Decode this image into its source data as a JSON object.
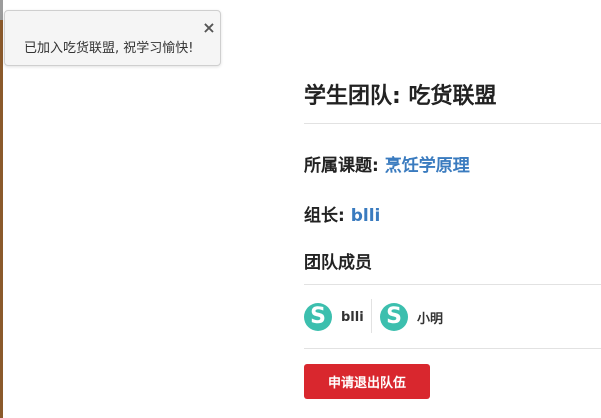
{
  "toast": {
    "message": "已加入吃货联盟, 祝学习愉快!",
    "close_icon": "close-icon",
    "close_glyph": "×"
  },
  "page": {
    "title": "学生团队: 吃货联盟"
  },
  "course": {
    "label": "所属课题: ",
    "value": "烹饪学原理"
  },
  "leader": {
    "label": "组长: ",
    "value": "blli"
  },
  "members_section": {
    "title": "团队成员",
    "members": [
      {
        "avatar_letter": "S",
        "name": "blli"
      },
      {
        "avatar_letter": "S",
        "name": "小明"
      }
    ]
  },
  "actions": {
    "quit_label": "申请退出队伍"
  },
  "colors": {
    "link": "#3a7bbf",
    "avatar": "#3cbfae",
    "danger": "#d9272e"
  }
}
